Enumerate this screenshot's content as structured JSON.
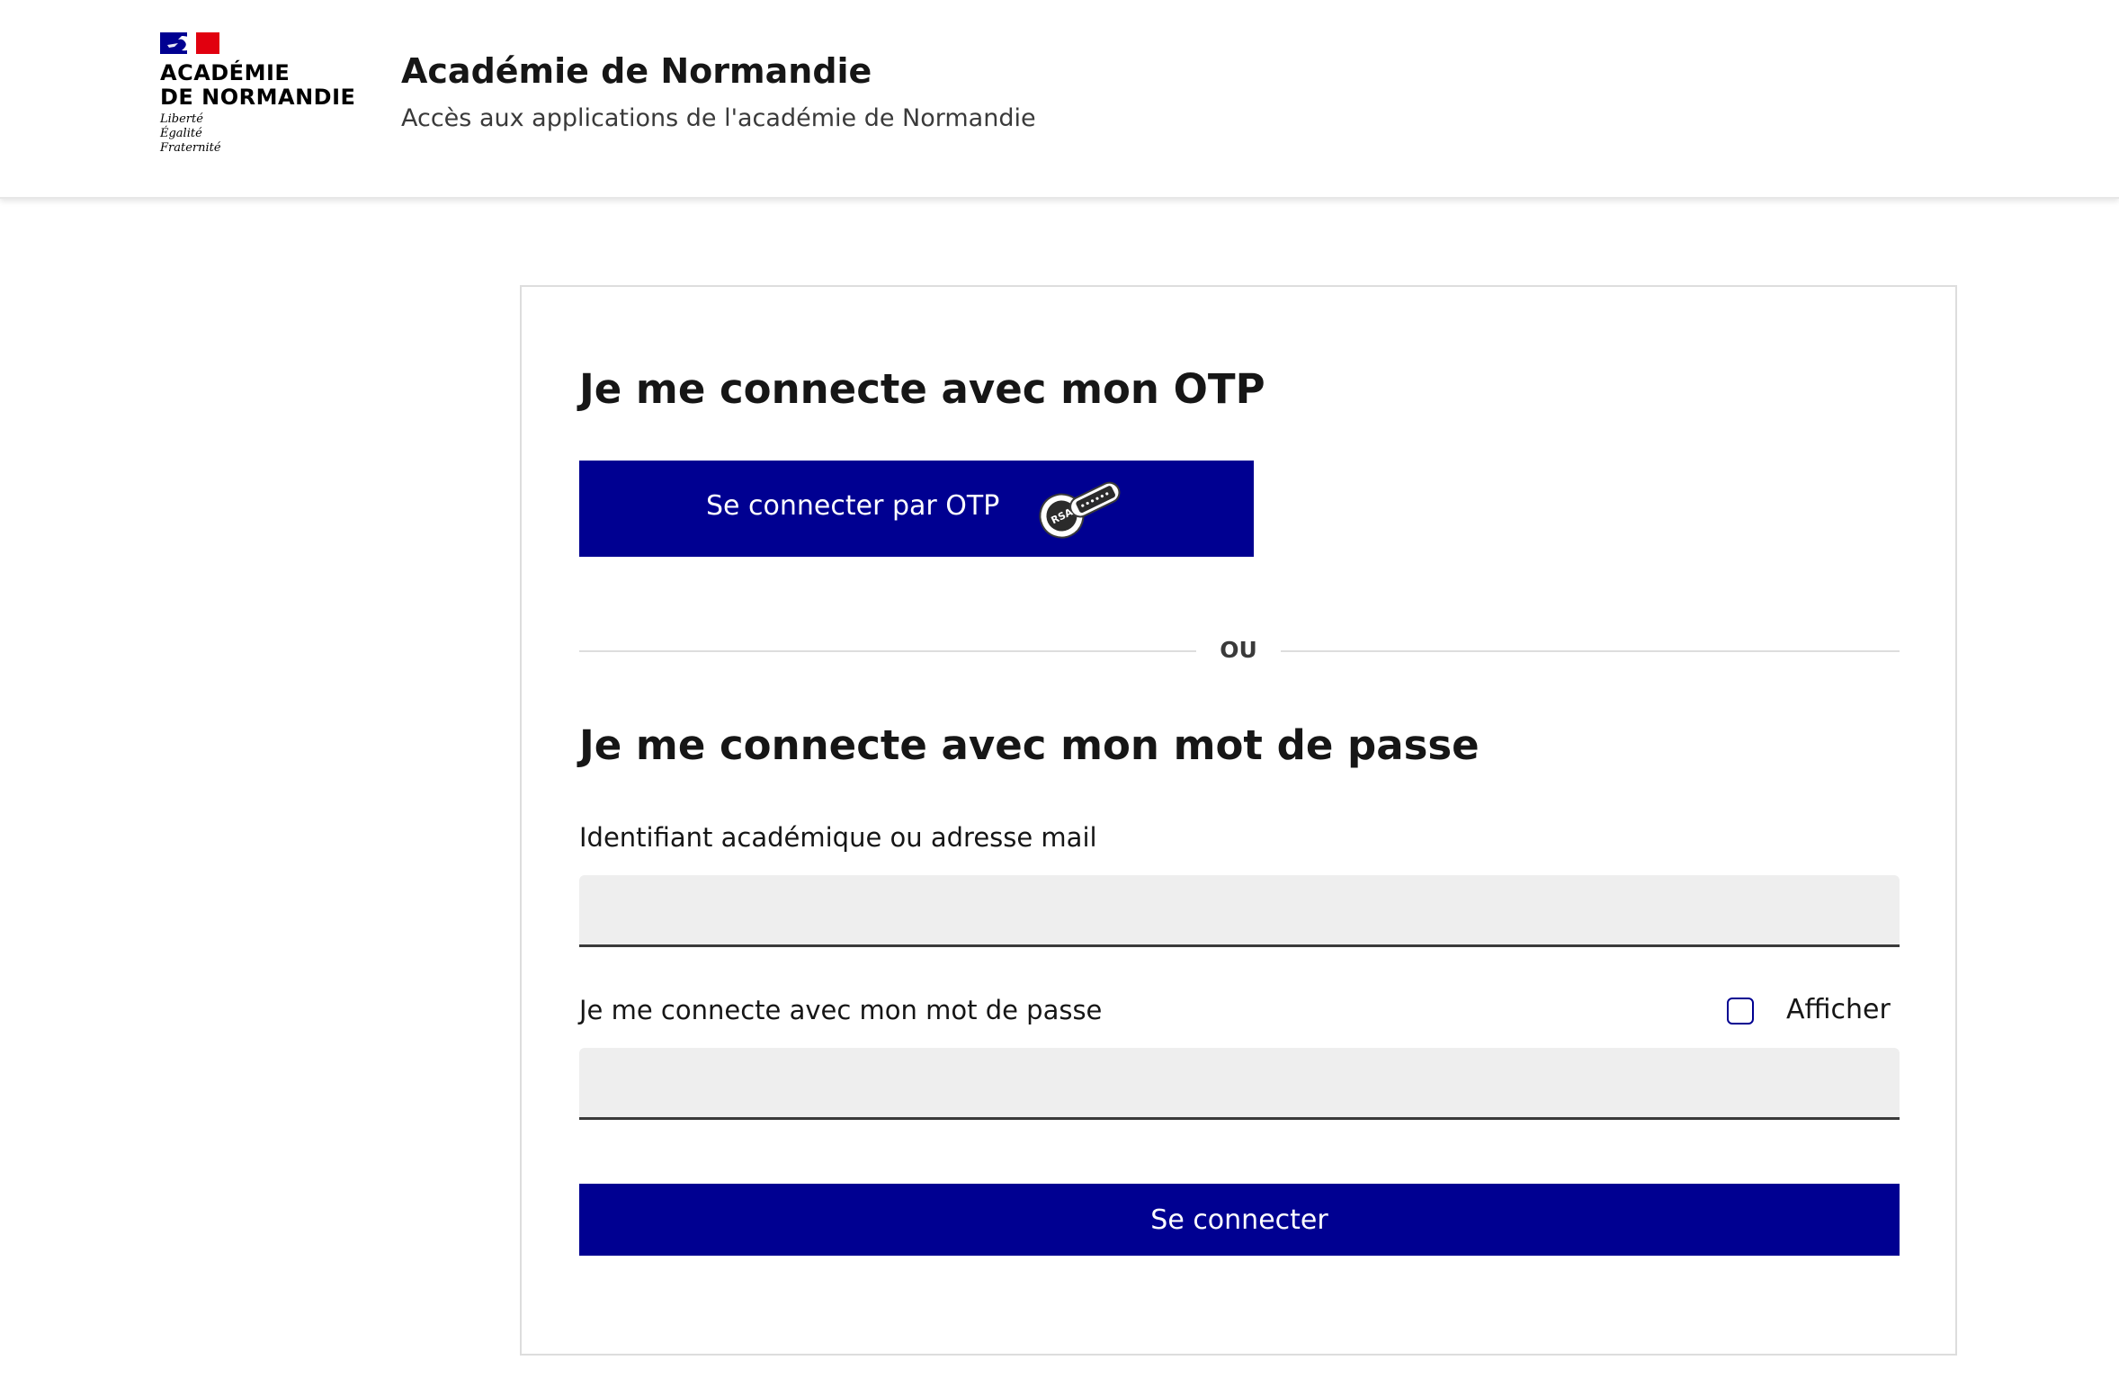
{
  "header": {
    "logo": {
      "name_line1": "Académie",
      "name_line2": "de Normandie",
      "motto": [
        "Liberté",
        "Égalité",
        "Fraternité"
      ]
    },
    "title": "Académie de Normandie",
    "subtitle": "Accès aux applications de l'académie de Normandie"
  },
  "otp": {
    "heading": "Je me connecte avec mon OTP",
    "button_label": "Se connecter par OTP",
    "token_brand": "RSA",
    "icon": "otp-token-icon"
  },
  "separator": {
    "text": "OU"
  },
  "password": {
    "heading": "Je me connecte avec mon mot de passe",
    "id_label": "Identifiant académique ou adresse mail",
    "id_value": "",
    "password_label": "Je me connecte avec mon mot de passe",
    "password_value": "",
    "show_label": "Afficher",
    "show_checked": false,
    "submit_label": "Se connecter"
  },
  "colors": {
    "primary": "#000091",
    "flag_blue": "#000091",
    "flag_red": "#e1000f",
    "input_bg": "#eeeeee",
    "text": "#161616"
  }
}
